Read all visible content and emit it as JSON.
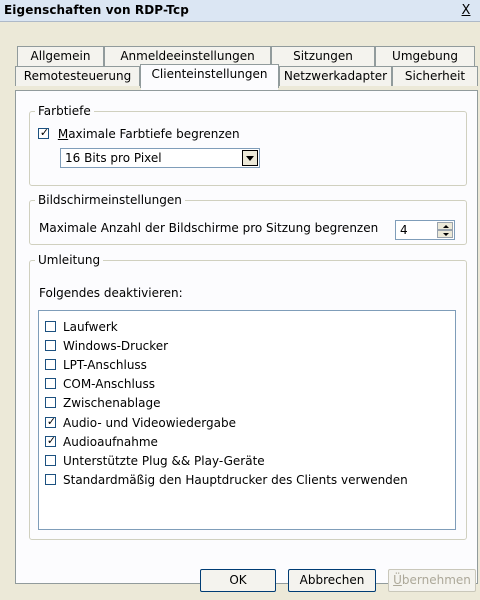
{
  "window": {
    "title": "Eigenschaften von RDP-Tcp",
    "close_label": "X"
  },
  "tabs_row1": [
    "Allgemein",
    "Anmeldeeinstellungen",
    "Sitzungen",
    "Umgebung"
  ],
  "tabs_row2": [
    "Remotesteuerung",
    "Clienteinstellungen",
    "Netzwerkadapter",
    "Sicherheit"
  ],
  "active_tab": "Clienteinstellungen",
  "farbtiefe": {
    "legend": "Farbtiefe",
    "checkbox_first": "M",
    "checkbox_rest": "aximale Farbtiefe begrenzen",
    "checked": true,
    "select_value": "16 Bits pro Pixel"
  },
  "bildschirm": {
    "legend": "Bildschirmeinstellungen",
    "label": "Maximale Anzahl der Bildschirme pro Sitzung begrenzen",
    "value": "4"
  },
  "umleitung": {
    "legend": "Umleitung",
    "label": "Folgendes deaktivieren:",
    "items": [
      {
        "label": "Laufwerk",
        "checked": false
      },
      {
        "label": "Windows-Drucker",
        "checked": false
      },
      {
        "label": "LPT-Anschluss",
        "checked": false
      },
      {
        "label": "COM-Anschluss",
        "checked": false
      },
      {
        "label": "Zwischenablage",
        "checked": false
      },
      {
        "label": "Audio- und Videowiedergabe",
        "checked": true
      },
      {
        "label": "Audioaufnahme",
        "checked": true
      },
      {
        "label": "Unterstützte Plug && Play-Geräte",
        "checked": false
      },
      {
        "label": "Standardmäßig den Hauptdrucker des Clients verwenden",
        "checked": false
      }
    ]
  },
  "buttons": {
    "ok": "OK",
    "cancel": "Abbrechen",
    "apply_first": "Ü",
    "apply_rest": "bernehmen"
  }
}
